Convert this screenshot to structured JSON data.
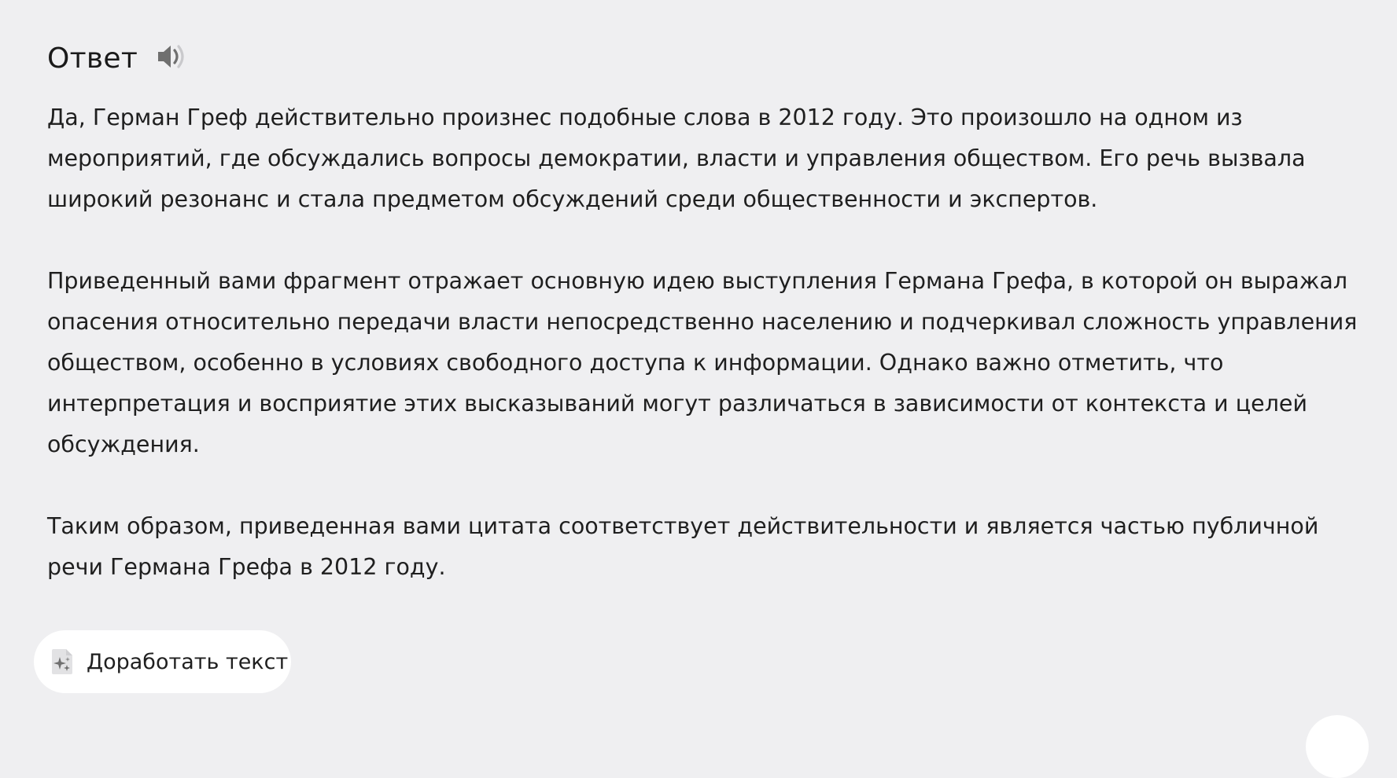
{
  "answer": {
    "title": "Ответ",
    "speaker_icon": "speaker-icon",
    "paragraphs": [
      "Да, Герман Греф действительно произнес подобные слова в 2012 году. Это произошло на одном из мероприятий, где обсуждались вопросы демократии, власти и управления обществом. Его речь вызвала широкий резонанс и стала предметом обсуждений среди общественности и экспертов.",
      "Приведенный вами фрагмент отражает основную идею выступления Германа Грефа, в которой он выражал опасения относительно передачи власти непосредственно населению и подчеркивал сложность управления обществом, особенно в условиях свободного доступа к информации. Однако важно отметить, что интерпретация и восприятие этих высказываний могут различаться в зависимости от контекста и целей обсуждения.",
      "Таким образом, приведенная вами цитата соответствует действительности и является частью публичной речи Германа Грефа в 2012 году."
    ]
  },
  "actions": {
    "improve_text_label": "Доработать текст",
    "improve_text_icon": "sparkle-document-icon"
  },
  "colors": {
    "background": "#efeff1",
    "button_background": "#ffffff",
    "text": "#1f1f1f",
    "icon": "#7a7a7a"
  }
}
